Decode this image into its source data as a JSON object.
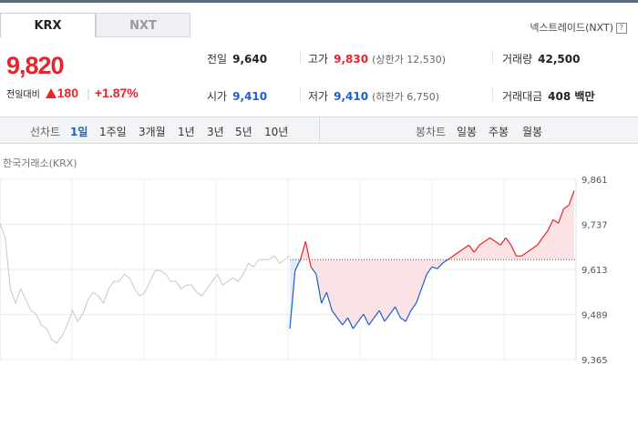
{
  "tabs": [
    {
      "label": "KRX",
      "active": true
    },
    {
      "label": "NXT",
      "active": false
    }
  ],
  "nxt_link": {
    "label": "넥스트레이드(NXT)",
    "icon": "help-icon",
    "icon_text": "?"
  },
  "price": {
    "current": "9,820",
    "change_label": "전일대비",
    "change_abs": "180",
    "change_pct": "+1.87%",
    "color": "#e8232b"
  },
  "stats": {
    "prev_close": {
      "label": "전일",
      "value": "9,640"
    },
    "high": {
      "label": "고가",
      "value": "9,830",
      "sub": "(상한가 12,530)"
    },
    "volume": {
      "label": "거래량",
      "value": "42,500"
    },
    "open": {
      "label": "시가",
      "value": "9,410"
    },
    "low": {
      "label": "저가",
      "value": "9,410",
      "sub": "(하한가 6,750)"
    },
    "amount": {
      "label": "거래대금",
      "value": "408 백만"
    }
  },
  "toolbar": {
    "line_label": "선차트",
    "line_periods": [
      "1일",
      "1주일",
      "3개월",
      "1년",
      "3년",
      "5년",
      "10년"
    ],
    "active_period": "1일",
    "candle_label": "봉차트",
    "candle_periods": [
      "일봉",
      "주봉",
      "월봉"
    ]
  },
  "chart_source": "한국거래소(KRX)",
  "colors": {
    "up": "#e8232b",
    "down": "#1a5fd0",
    "prev_series": "#c8c8c8"
  },
  "chart_data": {
    "type": "line",
    "y_ticks": [
      "9,861",
      "9,737",
      "9,613",
      "9,489",
      "9,365"
    ],
    "ylim": [
      9365,
      9861
    ],
    "baseline": 9640,
    "grid": true,
    "prev_day_series": [
      9740,
      9700,
      9560,
      9520,
      9560,
      9530,
      9500,
      9490,
      9460,
      9450,
      9420,
      9410,
      9430,
      9460,
      9500,
      9470,
      9490,
      9530,
      9550,
      9540,
      9520,
      9560,
      9580,
      9580,
      9600,
      9590,
      9560,
      9540,
      9550,
      9580,
      9610,
      9610,
      9600,
      9580,
      9580,
      9560,
      9570,
      9570,
      9550,
      9540,
      9560,
      9580,
      9600,
      9570,
      9580,
      9590,
      9580,
      9600,
      9630,
      9620,
      9640,
      9640,
      9640,
      9650,
      9630,
      9640,
      9650
    ],
    "today_series": [
      9450,
      9610,
      9640,
      9690,
      9620,
      9600,
      9520,
      9550,
      9500,
      9480,
      9460,
      9480,
      9450,
      9470,
      9490,
      9460,
      9480,
      9500,
      9470,
      9490,
      9510,
      9480,
      9470,
      9500,
      9520,
      9560,
      9600,
      9620,
      9615,
      9630,
      9640,
      9650,
      9660,
      9670,
      9680,
      9660,
      9680,
      9690,
      9700,
      9690,
      9680,
      9700,
      9680,
      9650,
      9650,
      9660,
      9670,
      9680,
      9700,
      9720,
      9750,
      9740,
      9780,
      9790,
      9830
    ]
  }
}
